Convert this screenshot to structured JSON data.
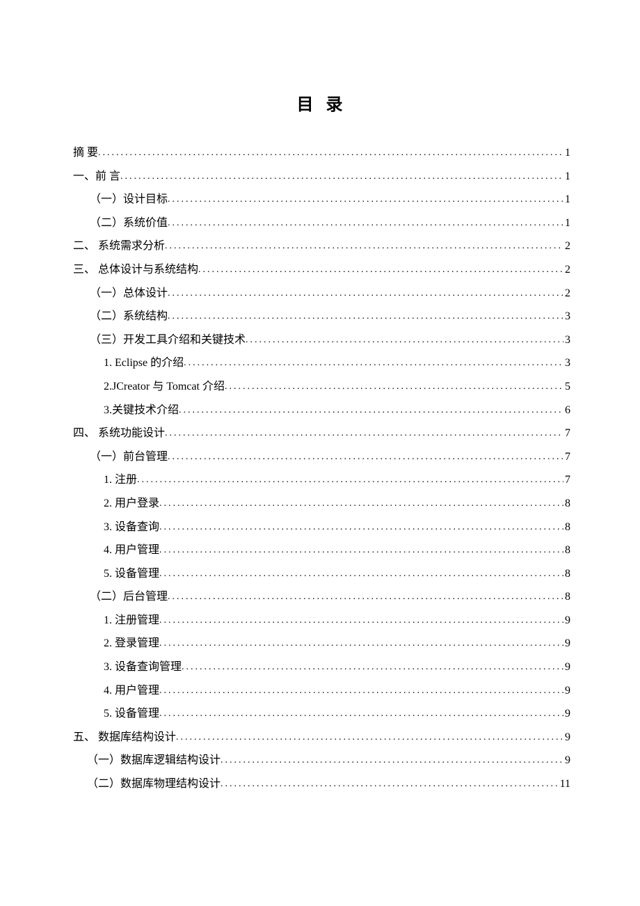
{
  "title": "目 录",
  "entries": [
    {
      "label": "摘 要",
      "page": "1",
      "indent": 0
    },
    {
      "label": "一、前 言",
      "page": "1",
      "indent": 0
    },
    {
      "label": "（一）设计目标",
      "page": "1",
      "indent": 1
    },
    {
      "label": "（二）系统价值",
      "page": "1",
      "indent": 1
    },
    {
      "label": "二、 系统需求分析",
      "page": "2",
      "indent": 0
    },
    {
      "label": "三、 总体设计与系统结构",
      "page": "2",
      "indent": 0
    },
    {
      "label": "（一）总体设计",
      "page": "2",
      "indent": 1
    },
    {
      "label": "（二）系统结构",
      "page": "3",
      "indent": 1
    },
    {
      "label": "（三）开发工具介绍和关键技术",
      "page": "3",
      "indent": 1
    },
    {
      "label": "1. Eclipse 的介绍 ",
      "page": "3",
      "indent": 2
    },
    {
      "label": "2.JCreator 与 Tomcat 介绍",
      "page": "5",
      "indent": 2
    },
    {
      "label": "3.关键技术介绍 ",
      "page": "6",
      "indent": 2
    },
    {
      "label": "四、 系统功能设计",
      "page": "7",
      "indent": 0
    },
    {
      "label": "（一）前台管理",
      "page": "7",
      "indent": 1
    },
    {
      "label": "1.  注册 ",
      "page": "7",
      "indent": 2
    },
    {
      "label": "2.  用户登录 ",
      "page": "8",
      "indent": 2
    },
    {
      "label": "3.  设备查询 ",
      "page": "8",
      "indent": 2
    },
    {
      "label": "4.  用户管理 ",
      "page": "8",
      "indent": 2
    },
    {
      "label": "5.  设备管理 ",
      "page": "8",
      "indent": 2
    },
    {
      "label": "（二）后台管理",
      "page": "8",
      "indent": 1
    },
    {
      "label": "1.  注册管理 ",
      "page": "9",
      "indent": 2
    },
    {
      "label": "2.  登录管理 ",
      "page": "9",
      "indent": 2
    },
    {
      "label": "3.  设备查询管理 ",
      "page": "9",
      "indent": 2
    },
    {
      "label": "4.  用户管理 ",
      "page": "9",
      "indent": 2
    },
    {
      "label": "5.  设备管理 ",
      "page": "9",
      "indent": 2
    },
    {
      "label": "五、 数据库结构设计",
      "page": "9",
      "indent": 0
    },
    {
      "label": "（一）数据库逻辑结构设计",
      "page": "9",
      "indent": 3
    },
    {
      "label": "（二）数据库物理结构设计",
      "page": "11",
      "indent": 3
    }
  ]
}
